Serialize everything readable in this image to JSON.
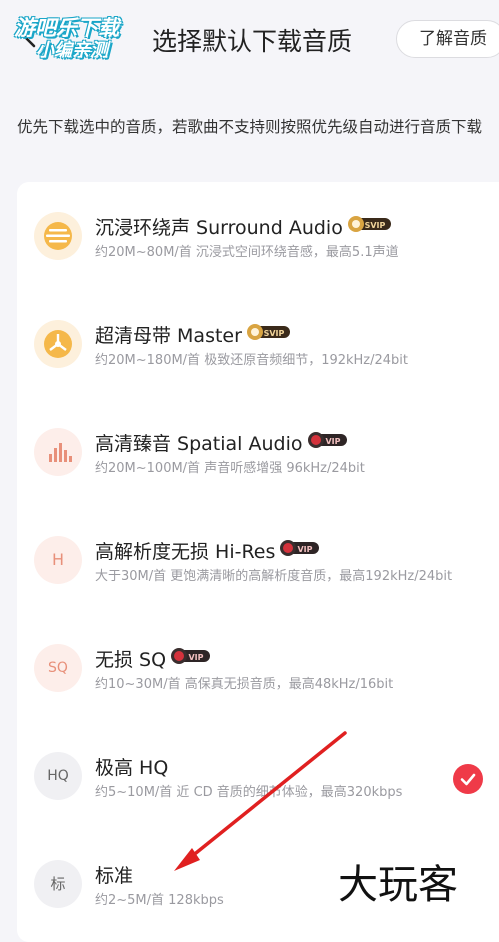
{
  "header": {
    "watermark_line1": "游吧乐下载",
    "watermark_line2": "小编亲测",
    "title": "选择默认下载音质",
    "learn_button": "了解音质"
  },
  "description": "优先下载选中的音质，若歌曲不支持则按照优先级自动进行音质下载",
  "options": [
    {
      "name": "沉浸环绕声  Surround Audio",
      "badge": "SVIP",
      "sub": "约20M~80M/首 沉浸式空间环绕音感，最高5.1声道",
      "icon": "surround-icon"
    },
    {
      "name": "超清母带  Master",
      "badge": "SVIP",
      "sub": "约20M~180M/首 极致还原音频细节，192kHz/24bit",
      "icon": "master-icon"
    },
    {
      "name": "高清臻音  Spatial Audio",
      "badge": "VIP",
      "sub": "约20M~100M/首 声音听感增强 96kHz/24bit",
      "icon": "spatial-icon"
    },
    {
      "name": "高解析度无损  Hi-Res",
      "badge": "VIP",
      "sub": "大于30M/首 更饱满清晰的高解析度音质，最高192kHz/24bit",
      "icon_text": "H"
    },
    {
      "name": "无损  SQ",
      "badge": "VIP",
      "sub": "约10~30M/首 高保真无损音质，最高48kHz/16bit",
      "icon_text": "SQ"
    },
    {
      "name": "极高  HQ",
      "badge": "",
      "sub": "约5~10M/首 近 CD 音质的细节体验，最高320kbps",
      "icon_text": "HQ",
      "selected": true
    },
    {
      "name": "标准",
      "badge": "",
      "sub": "约2~5M/首 128kbps",
      "icon_text": "标"
    }
  ],
  "watermark_bottom": "大玩客",
  "colors": {
    "svip_gold": "#d9a441",
    "vip_red": "#d4323c",
    "selected_red": "#ef3a48",
    "annotation_arrow": "#e02020"
  }
}
